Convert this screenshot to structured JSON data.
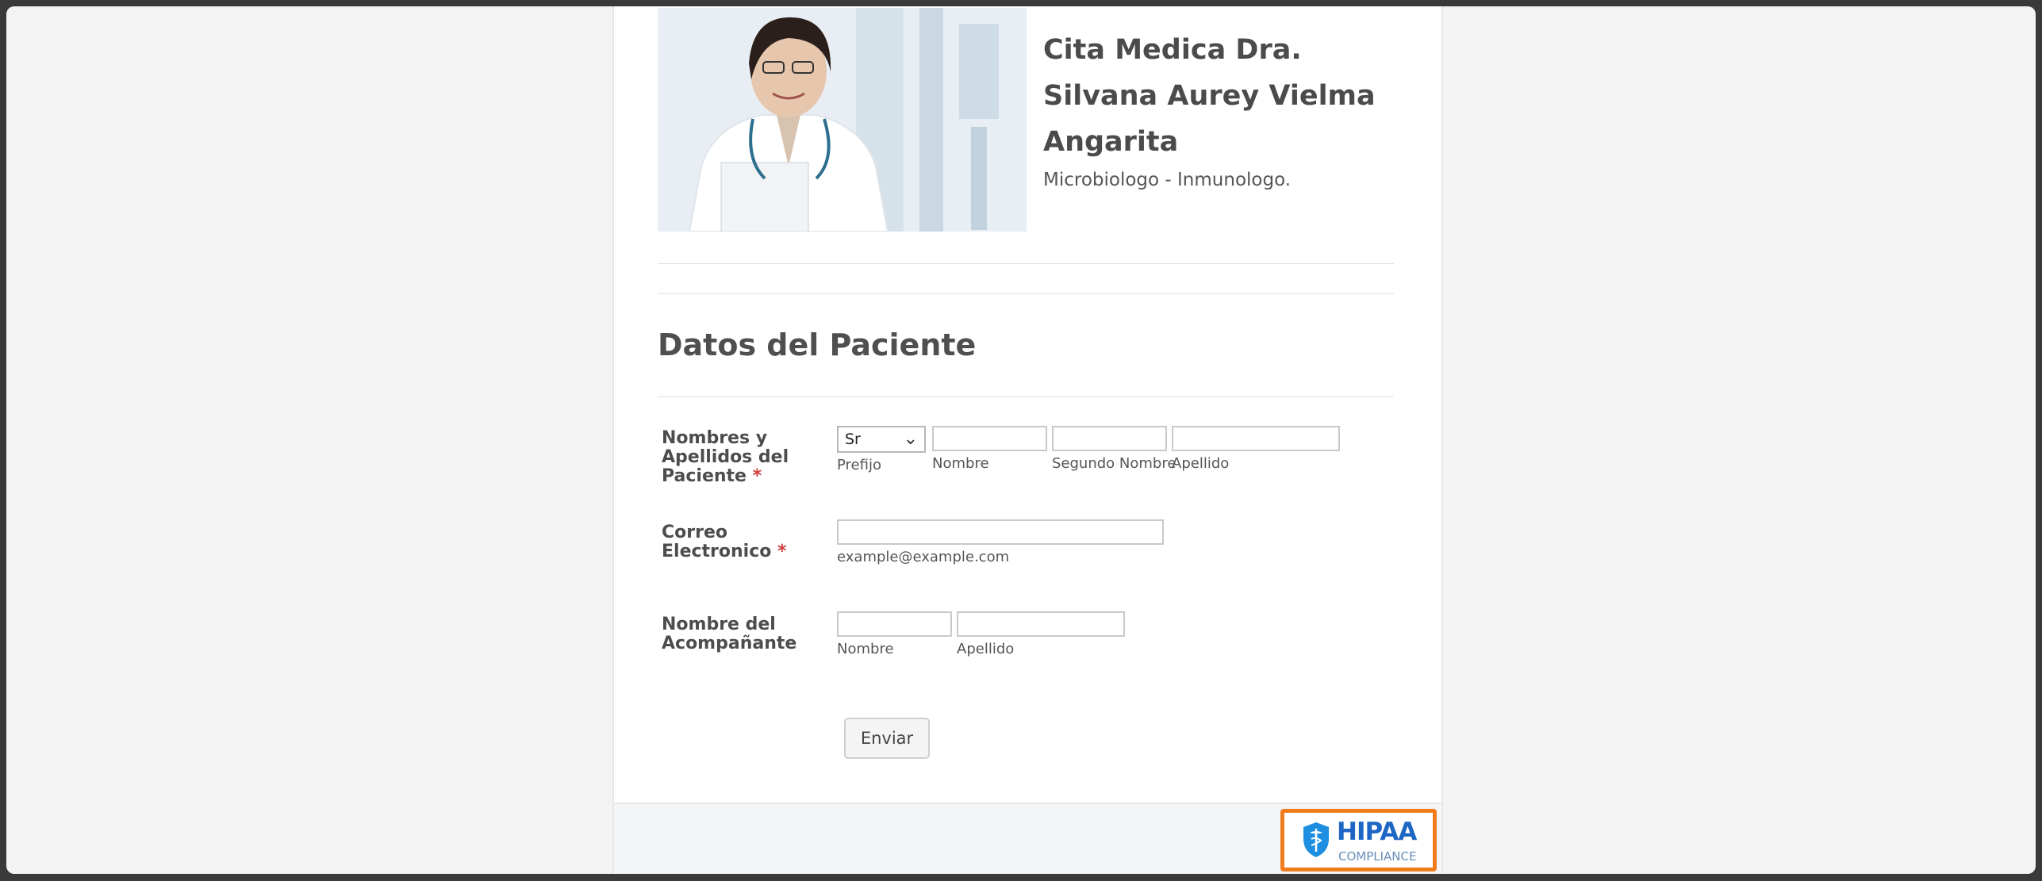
{
  "header": {
    "title": "Cita Medica Dra. Silvana Aurey Vielma Angarita",
    "subtitle": "Microbiologo - Inmunologo."
  },
  "section": {
    "title": "Datos del Paciente"
  },
  "form": {
    "patient_name": {
      "label": "Nombres y Apellidos del Paciente",
      "required_mark": "*",
      "prefix_value": "Sr",
      "prefix_caption": "Prefijo",
      "first_caption": "Nombre",
      "middle_caption": "Segundo Nombre",
      "last_caption": "Apellido"
    },
    "email": {
      "label": "Correo Electronico",
      "required_mark": "*",
      "hint": "example@example.com"
    },
    "companion": {
      "label": "Nombre del Acompañante",
      "first_caption": "Nombre",
      "last_caption": "Apellido"
    },
    "submit_label": "Enviar"
  },
  "footer": {
    "badge_title": "HIPAA",
    "badge_subtitle": "COMPLIANCE",
    "badge_icon": "shield-caduceus-icon",
    "accent": "#f07c1e"
  }
}
